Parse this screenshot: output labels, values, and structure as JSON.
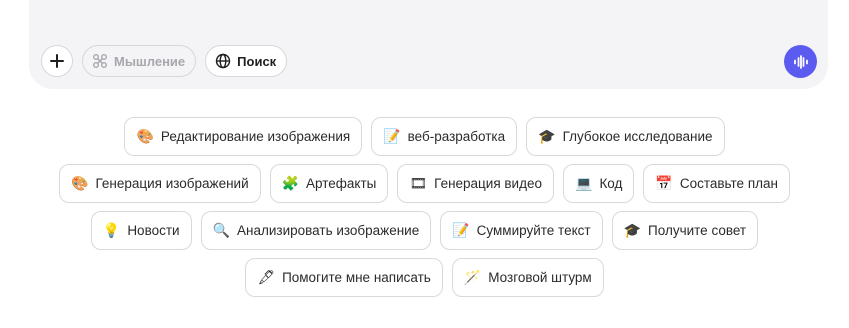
{
  "composer": {
    "thinking_label": "Мышление",
    "search_label": "Поиск",
    "colors": {
      "accent": "#5b5bf0",
      "panel": "#f4f4f6"
    }
  },
  "suggestions": [
    [
      {
        "icon": "palette-icon",
        "glyph": "🎨",
        "label": "Редактирование изображения"
      },
      {
        "icon": "memo-icon",
        "glyph": "📝",
        "label": "веб-разработка"
      },
      {
        "icon": "graduation-cap-icon",
        "glyph": "🎓",
        "label": "Глубокое исследование"
      }
    ],
    [
      {
        "icon": "palette-icon",
        "glyph": "🎨",
        "label": "Генерация изображений"
      },
      {
        "icon": "puzzle-icon",
        "glyph": "🧩",
        "label": "Артефакты"
      },
      {
        "icon": "film-icon",
        "glyph": "🎞",
        "label": "Генерация видео"
      },
      {
        "icon": "laptop-icon",
        "glyph": "💻",
        "label": "Код"
      },
      {
        "icon": "calendar-icon",
        "glyph": "📅",
        "label": "Составьте план"
      }
    ],
    [
      {
        "icon": "lightbulb-icon",
        "glyph": "💡",
        "label": "Новости"
      },
      {
        "icon": "magnifier-icon",
        "glyph": "🔍",
        "label": "Анализировать изображение"
      },
      {
        "icon": "memo-icon",
        "glyph": "📝",
        "label": "Суммируйте текст"
      },
      {
        "icon": "graduation-cap-icon",
        "glyph": "🎓",
        "label": "Получите совет"
      }
    ],
    [
      {
        "icon": "pen-icon",
        "glyph": "🖋",
        "label": "Помогите мне написать"
      },
      {
        "icon": "magic-wand-icon",
        "glyph": "🪄",
        "label": "Мозговой штурм"
      }
    ]
  ]
}
